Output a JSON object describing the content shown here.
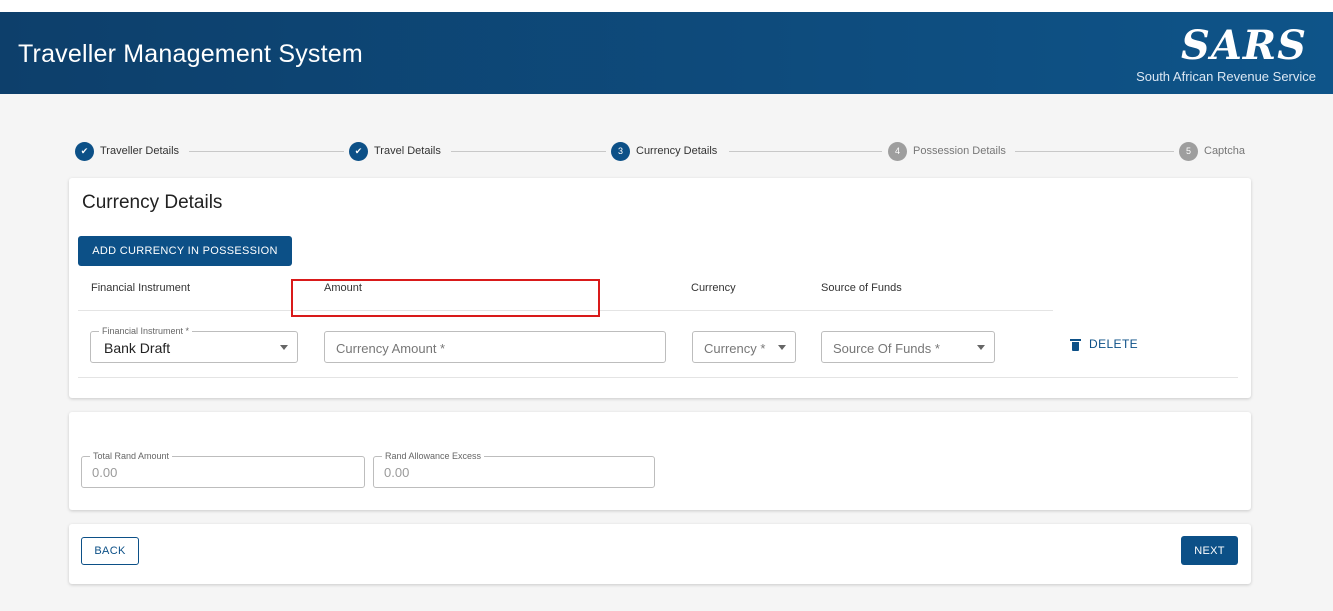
{
  "header": {
    "title": "Traveller Management System",
    "logo_text": "SARS",
    "logo_subtitle": "South African Revenue Service"
  },
  "stepper": {
    "steps": [
      {
        "label": "Traveller Details",
        "state": "done",
        "number": "1"
      },
      {
        "label": "Travel Details",
        "state": "done",
        "number": "2"
      },
      {
        "label": "Currency Details",
        "state": "active",
        "number": "3"
      },
      {
        "label": "Possession Details",
        "state": "todo",
        "number": "4"
      },
      {
        "label": "Captcha",
        "state": "todo",
        "number": "5"
      }
    ]
  },
  "currency_section": {
    "title": "Currency Details",
    "add_button_label": "ADD CURRENCY IN POSSESSION",
    "columns": [
      "Financial Instrument",
      "Amount",
      "Currency",
      "Source of Funds"
    ],
    "row": {
      "financial_instrument": {
        "legend": "Financial Instrument *",
        "value": "Bank Draft"
      },
      "amount": {
        "placeholder": "Currency Amount *"
      },
      "currency": {
        "placeholder": "Currency *"
      },
      "source_of_funds": {
        "placeholder": "Source Of Funds *"
      },
      "delete_label": "DELETE"
    }
  },
  "totals": {
    "total_rand": {
      "legend": "Total Rand Amount",
      "value": "0.00"
    },
    "allowance_excess": {
      "legend": "Rand Allowance Excess",
      "value": "0.00"
    }
  },
  "navigation": {
    "back_label": "BACK",
    "next_label": "NEXT"
  },
  "colors": {
    "primary": "#0c5087",
    "header_dark": "#0d3f6b",
    "highlight": "#d91a1a"
  }
}
